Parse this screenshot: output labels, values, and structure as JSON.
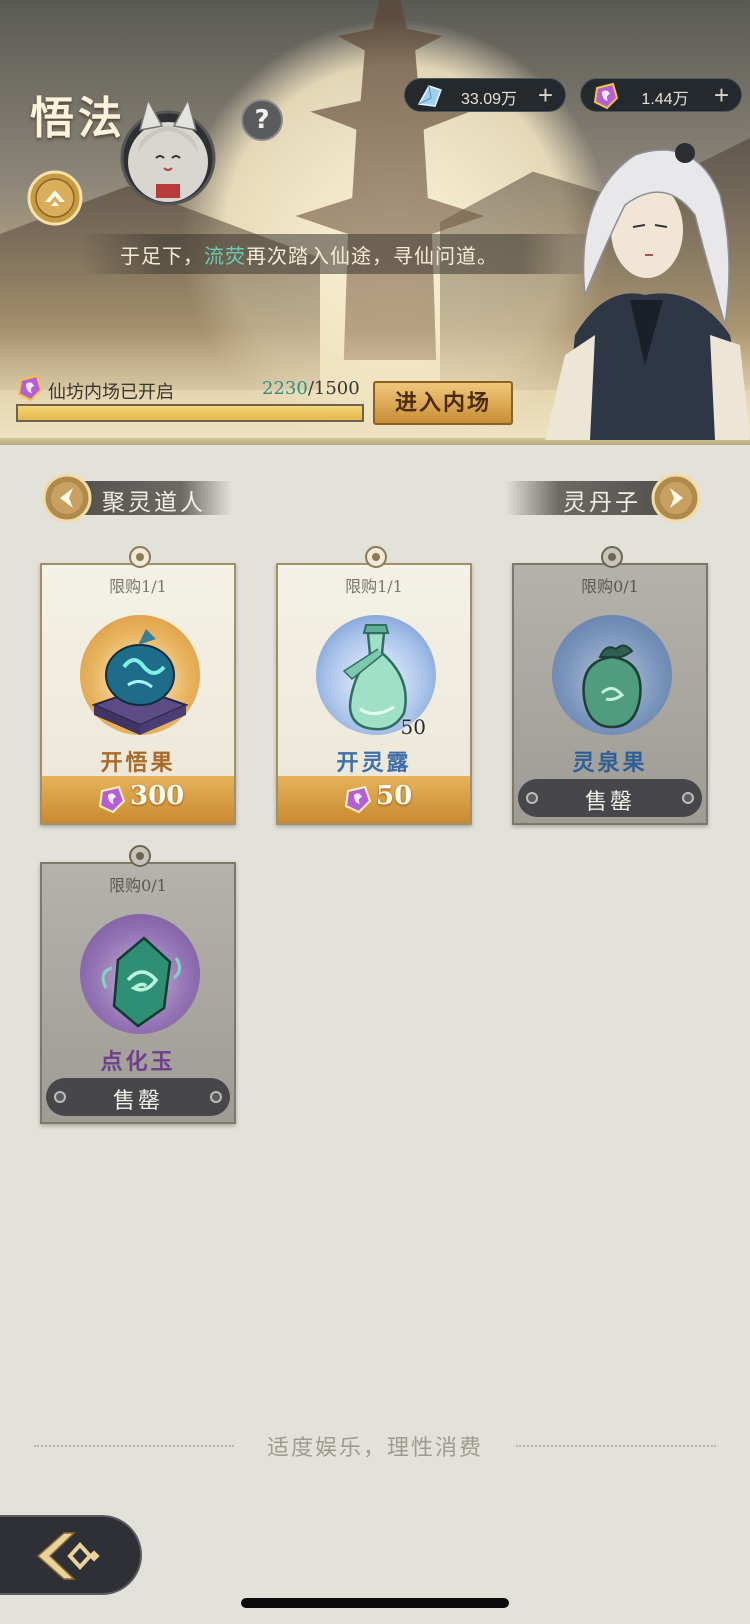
{
  "header": {
    "title": "悟法",
    "help_label": "?",
    "greeting_prefix": "于足下，",
    "greeting_name": "流荧",
    "greeting_suffix": "再次踏入仙途，寻仙问道。"
  },
  "currencies": [
    {
      "icon": "crystal-icon",
      "amount": "33.09万",
      "plus": "+"
    },
    {
      "icon": "spirit-coin-icon",
      "amount": "1.44万",
      "plus": "+"
    }
  ],
  "progress": {
    "label": "仙坊内场已开启",
    "current": "2230",
    "separator": "/",
    "max": "1500",
    "fill_fraction": 1.0
  },
  "enter_button": "进入内场",
  "merchant_nav": {
    "prev": "聚灵道人",
    "next": "灵丹子"
  },
  "items": [
    {
      "limit": "限购1/1",
      "name": "开悟果",
      "price": "300",
      "qty": "",
      "sold_out": false,
      "name_color": "#a9692a",
      "orb_color": "#d88f36"
    },
    {
      "limit": "限购1/1",
      "name": "开灵露",
      "price": "50",
      "qty": "50",
      "sold_out": false,
      "name_color": "#3f6fa8",
      "orb_color": "#5f86c4"
    },
    {
      "limit": "限购0/1",
      "name": "灵泉果",
      "price": "",
      "qty": "",
      "sold_out": true,
      "sold_label": "售罄",
      "name_color": "#2f5f99",
      "orb_color": "#4a79be"
    },
    {
      "limit": "限购0/1",
      "name": "点化玉",
      "price": "",
      "qty": "",
      "sold_out": true,
      "sold_label": "售罄",
      "name_color": "#6f3f8c",
      "orb_color": "#7a4fa6"
    }
  ],
  "footer": {
    "notice": "适度娱乐，理性消费"
  },
  "colors": {
    "accent_gold": "#e4b74a",
    "progress_current": "#2f8d83",
    "greeting_highlight": "#6fc9b5"
  }
}
